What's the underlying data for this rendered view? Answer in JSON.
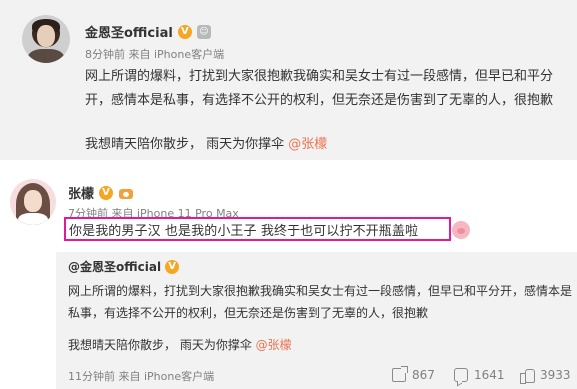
{
  "top_post": {
    "username": "金恩圣official",
    "verified_badge": "V",
    "meta_time": "8分钟前",
    "meta_source": "来自 iPhone客户端",
    "lines": [
      "网上所谓的爆料，打扰到大家很抱歉我确实和吴女士有过一段感情，但早已和平分",
      "开，感情本是私事，有选择不公开的权利，但无奈还是伤害到了无辜的人，很抱歉"
    ],
    "last_line_prefix": "我想晴天陪你散步，  雨天为你撑伞",
    "mention": "@张檬"
  },
  "reply_post": {
    "username": "张檬",
    "verified_badge": "V",
    "meta_time": "7分钟前",
    "meta_source": "来自 iPhone 11 Pro Max",
    "comment": "你是我的男子汉  也是我的小王子  我终于也可以拧不开瓶盖啦"
  },
  "repost": {
    "username": "@金恩圣official",
    "verified_badge": "V",
    "lines": [
      "网上所谓的爆料，打扰到大家很抱歉我确实和吴女士有过一段感情，但早已和平分开，感情本是",
      "私事，有选择不公开的权利，但无奈还是伤害到了无辜的人，很抱歉"
    ],
    "last_line_prefix": "我想晴天陪你散步，  雨天为你撑伞",
    "mention": "@张檬",
    "meta_time": "11分钟前",
    "meta_source": "来自 iPhone客户端",
    "share_count": "867",
    "comment_count": "1641",
    "like_count": "3933"
  },
  "colors": {
    "highlight_border": "#e01a9a",
    "mention": "#eb7350",
    "verified": "#f5a623"
  },
  "icons": {
    "verified": "verified-v-icon",
    "pig": "pig-face-emoji-icon",
    "share": "share-icon",
    "comment": "comment-icon",
    "like": "like-icon"
  }
}
